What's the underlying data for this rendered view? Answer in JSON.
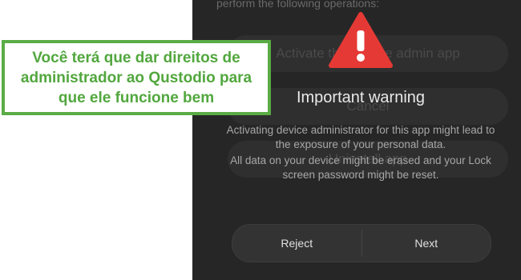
{
  "background": {
    "partial_text": "perform the following operations:",
    "activate_label": "Activate this device admin app",
    "cancel_label": "Cancel",
    "uninstall_label": "Uninstall app"
  },
  "dialog": {
    "icon": "warning-triangle-icon",
    "title": "Important warning",
    "message_1": "Activating device administrator for this app might lead to the exposure of your personal data.",
    "message_2": "All data on your device might be erased and your Lock screen password might be reset.",
    "reject_label": "Reject",
    "next_label": "Next"
  },
  "callout": {
    "text": "Você terá que dar direitos de administrador ao Qustodio para que ele funcione bem"
  },
  "colors": {
    "callout_green": "#5aac45",
    "warning_red": "#e53935",
    "phone_bg": "#262626"
  }
}
